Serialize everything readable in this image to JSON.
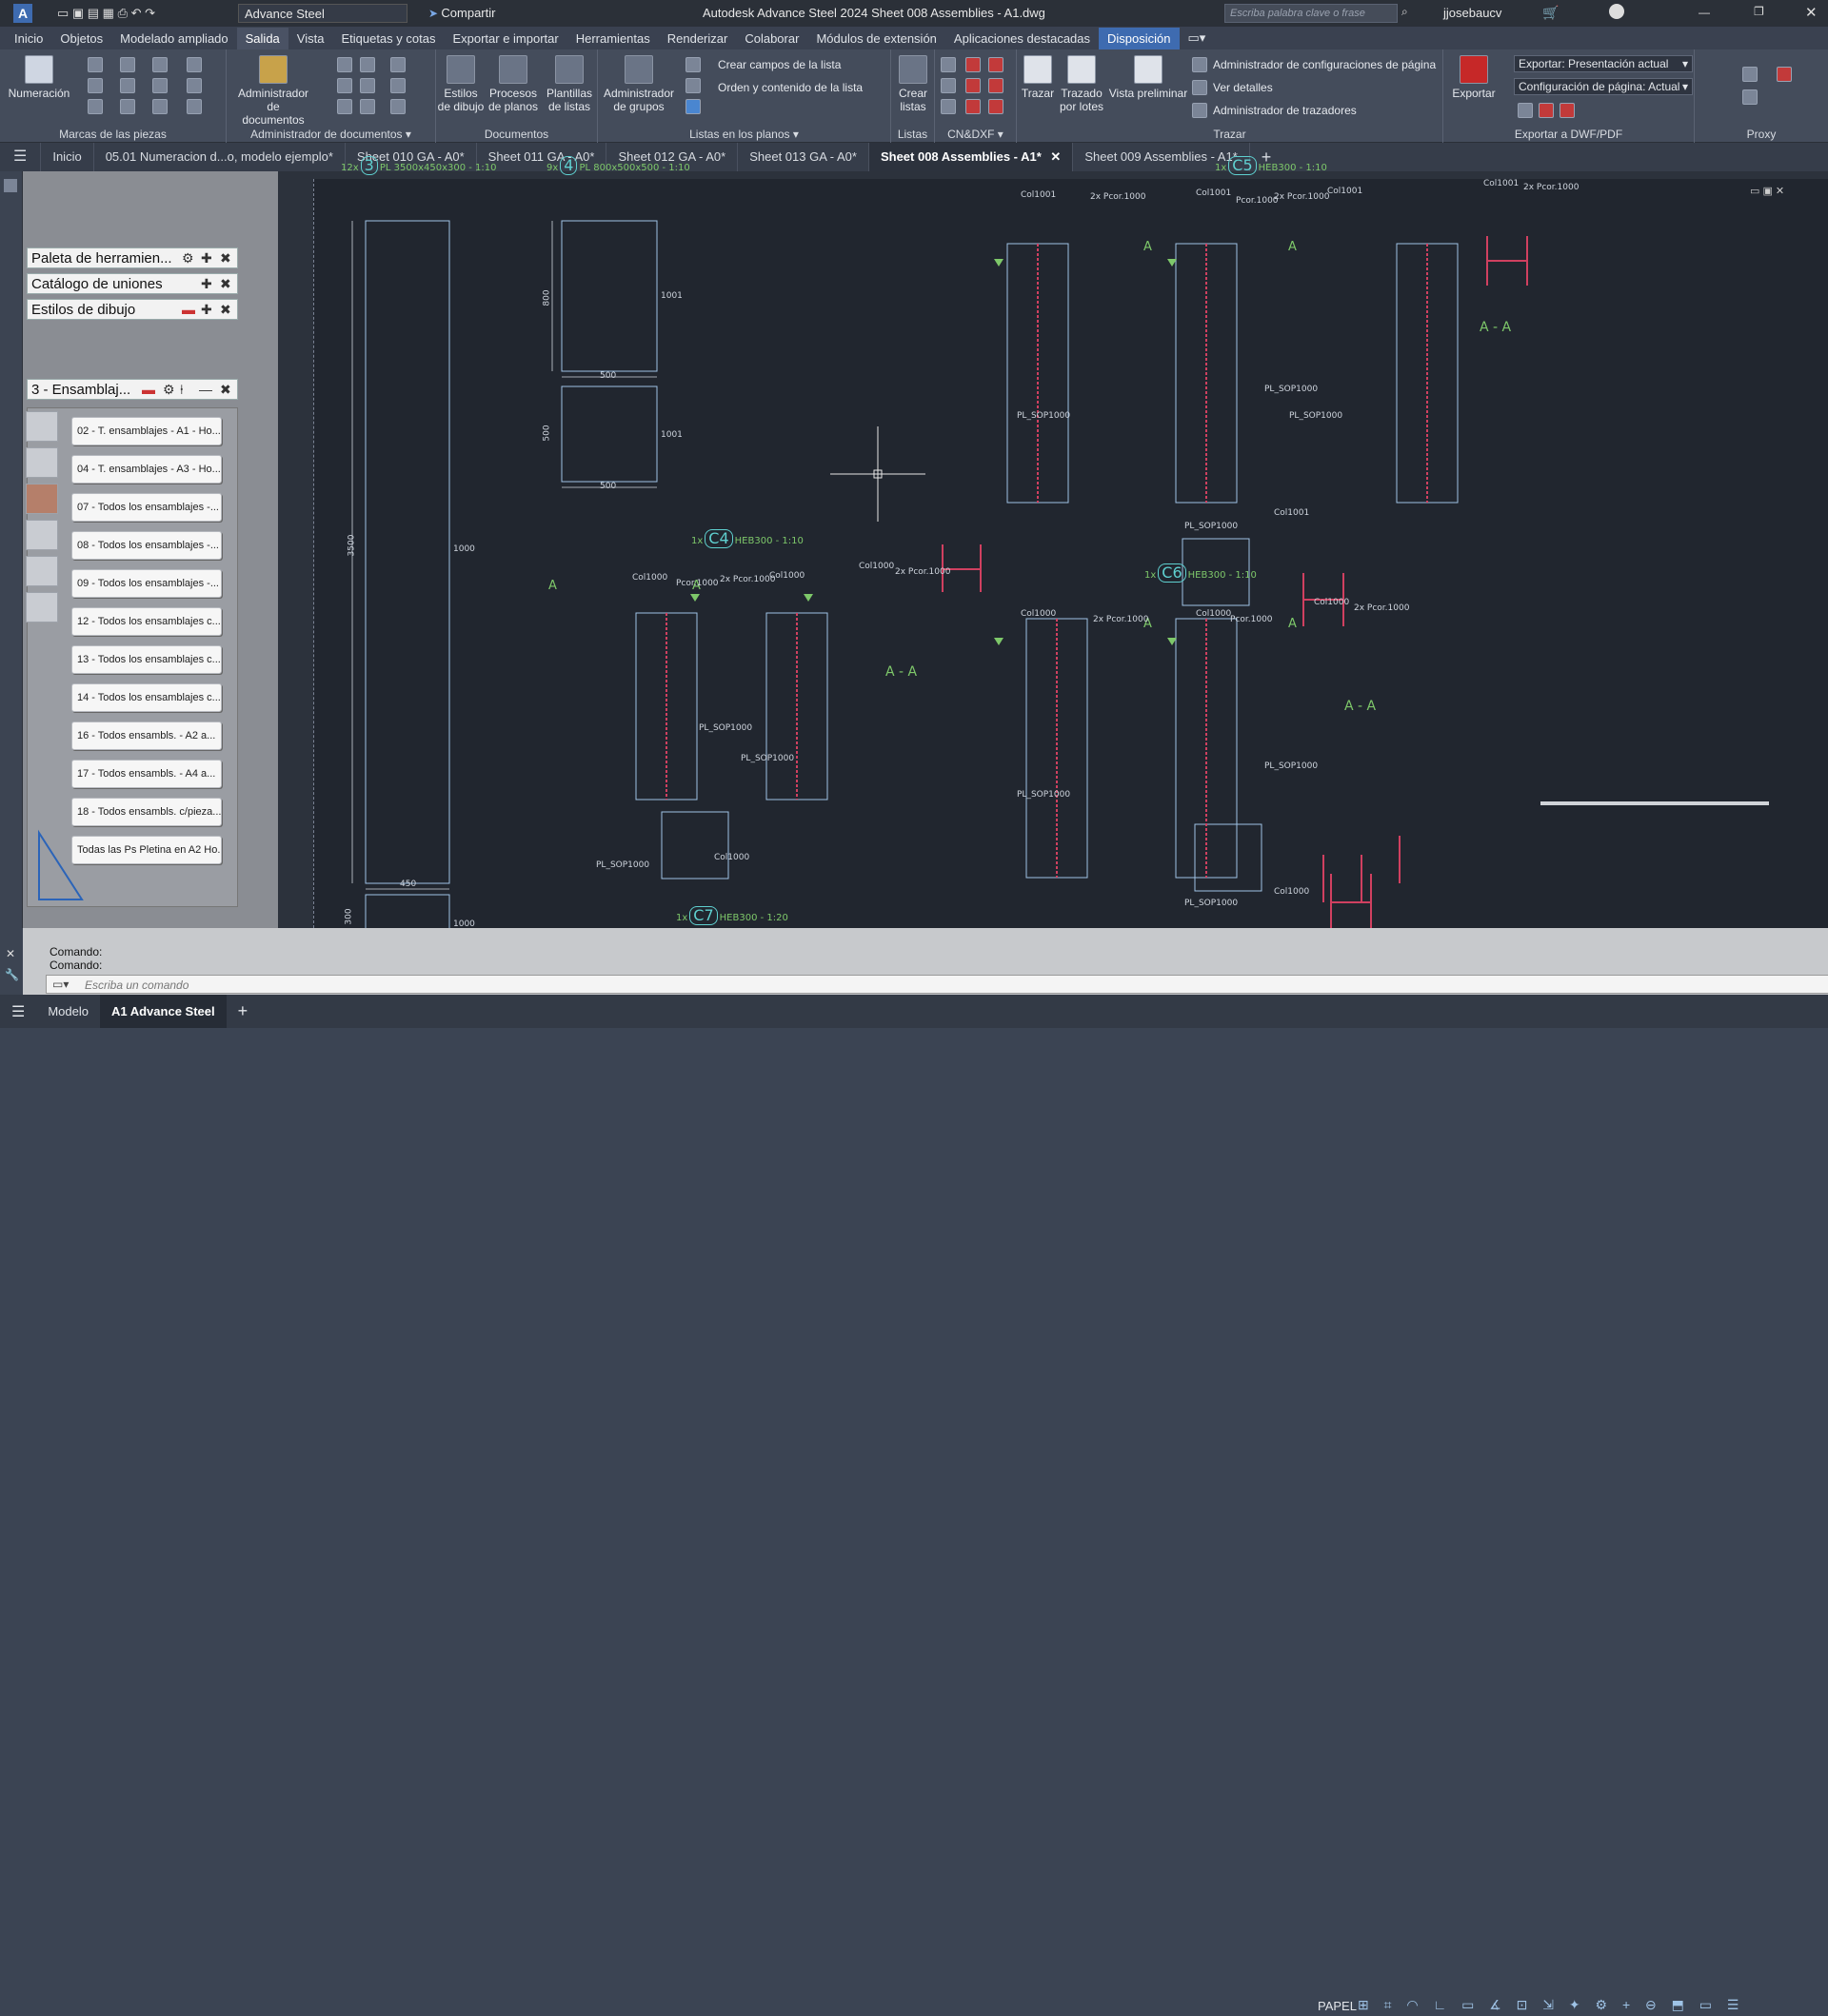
{
  "titlebar": {
    "app_icon": "A",
    "workspace": "Advance Steel",
    "share": "Compartir",
    "title": "Autodesk Advance Steel 2024    Sheet 008 Assemblies - A1.dwg",
    "search_placeholder": "Escriba palabra clave o frase",
    "user": "jjosebaucv"
  },
  "menu_tabs": [
    "Inicio",
    "Objetos",
    "Modelado ampliado",
    "Salida",
    "Vista",
    "Etiquetas y cotas",
    "Exportar e importar",
    "Herramientas",
    "Renderizar",
    "Colaborar",
    "Módulos de extensión",
    "Aplicaciones destacadas",
    "Disposición"
  ],
  "ribbon": {
    "numeracion": "Numeración",
    "marcas": "Marcas de las piezas",
    "admin_docs": "Administrador de documentos",
    "admin_docs_group": "Administrador de documentos ▾",
    "estilos_dibujo": "Estilos de dibujo",
    "procesos": "Procesos de planos",
    "plantillas": "Plantillas de listas",
    "documentos": "Documentos",
    "admin_grupos": "Administrador de grupos",
    "crear_campos": "Crear campos de la lista",
    "orden_contenido": "Orden y contenido de la lista",
    "listas_planos": "Listas en los planos ▾",
    "crear_listas": "Crear listas",
    "listas": "Listas",
    "cndxf": "CN&DXF ▾",
    "trazar": "Trazar",
    "trazado_lotes": "Trazado por lotes",
    "vista_preliminar": "Vista preliminar",
    "admin_config": "Administrador de configuraciones de página",
    "ver_detalles": "Ver detalles",
    "admin_trazadores": "Administrador de trazadores",
    "trazar_group": "Trazar",
    "exportar": "Exportar",
    "exportar_sel": "Exportar: Presentación actual",
    "config_sel": "Configuración de página: Actual",
    "export_group": "Exportar a DWF/PDF",
    "proxy": "Proxy"
  },
  "doc_tabs": [
    "Inicio",
    "05.01 Numeracion d...o, modelo ejemplo*",
    "Sheet 010 GA - A0*",
    "Sheet 011 GA - A0*",
    "Sheet 012 GA - A0*",
    "Sheet 013 GA - A0*",
    "Sheet 008 Assemblies - A1*",
    "Sheet 009 Assemblies - A1*"
  ],
  "palettes": {
    "herramientas": "Paleta de herramien...",
    "uniones": "Catálogo de uniones",
    "estilos": "Estilos de dibujo",
    "ensamblajes": "3 - Ensamblaj..."
  },
  "tool_items": [
    "02 - T. ensamblajes - A1 - Ho...",
    "04 - T. ensamblajes - A3 - Ho...",
    "07 - Todos los ensamblajes -...",
    "08 - Todos los ensamblajes -...",
    "09 - Todos los ensamblajes -...",
    "12 - Todos los ensamblajes c...",
    "13 - Todos los ensamblajes c...",
    "14 - Todos los ensamblajes c...",
    "16 - Todos ensambls. - A2 a...",
    "17 - Todos ensambls. - A4 a...",
    "18 - Todos ensambls. c/pieza...",
    "Todas las Ps Pletina en A2 Ho..."
  ],
  "drawing": {
    "p3_count": "12x",
    "p3_id": "3",
    "p3_desc": "PL 3500x450x300 - 1:10",
    "p4_count": "9x",
    "p4_id": "4",
    "p4_desc": "PL 800x500x500 - 1:10",
    "c4_count": "1x",
    "c4_id": "C4",
    "c4_desc": "HEB300 - 1:10",
    "c5_count": "1x",
    "c5_id": "C5",
    "c5_desc": "HEB300 - 1:10",
    "c6_count": "1x",
    "c6_id": "C6",
    "c6_desc": "HEB300 - 1:10",
    "c7_count": "1x",
    "c7_id": "C7",
    "c7_desc": "HEB300 - 1:20",
    "section": "A - A",
    "a": "A",
    "dim_3500": "3500",
    "dim_1000": "1000",
    "dim_450": "450",
    "dim_300": "300",
    "dim_800": "800",
    "dim_500": "500",
    "dim_1001": "1001",
    "col1000": "Col1000",
    "col1001": "Col1001",
    "pcor": "2x Pcor.1000",
    "pcor1": "Pcor.1000",
    "pl_sop": "PL_SOP1000"
  },
  "command": {
    "line1": "Comando:",
    "line2": "Comando:",
    "placeholder": "Escriba un comando"
  },
  "status": {
    "modelo": "Modelo",
    "layout": "A1 Advance Steel",
    "papel": "PAPEL"
  },
  "colors": {
    "accent": "#3e6bb0",
    "green": "#69c27a",
    "cyan": "#5fd0d0",
    "red": "#d04060"
  }
}
